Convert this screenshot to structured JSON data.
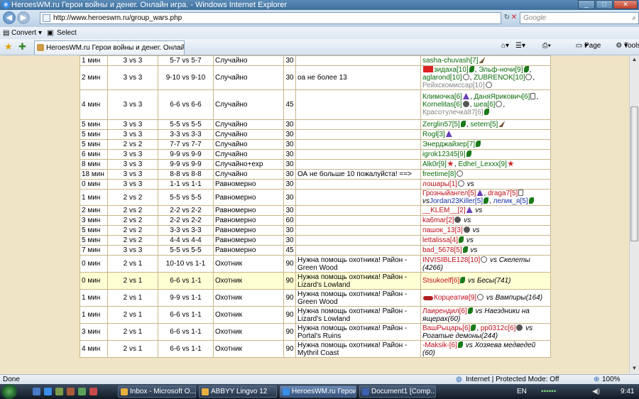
{
  "window": {
    "title": "HeroesWM.ru Герои войны и денег. Онлайн игра. - Windows Internet Explorer"
  },
  "address": {
    "url": "http://www.heroeswm.ru/group_wars.php",
    "search_placeholder": "Google"
  },
  "command_bar": {
    "convert": "Convert",
    "select": "Select"
  },
  "tab": {
    "label": "HeroesWM.ru Герои войны и денег. Онлайн иг..."
  },
  "toolbar": {
    "page": "Page",
    "tools": "Tools"
  },
  "rows": [
    {
      "time": "1 мин",
      "format": "3 vs 3",
      "levels": "5-7 vs 5-7",
      "type": "Случайно",
      "timeout": "30",
      "comment": "",
      "players": [
        {
          "name": "sasha-chuvash[7]",
          "color": "",
          "icon": "dart"
        }
      ]
    },
    {
      "time": "2 мин",
      "format": "3 vs 3",
      "levels": "9-10 vs 9-10",
      "type": "Случайно",
      "timeout": "30",
      "comment": "оа не более 13",
      "players": [
        {
          "name": "зидаха[10]",
          "color": "",
          "pre": "flag",
          "icon": "leaf"
        },
        {
          "name": "Эльф-ночи[9]",
          "color": "",
          "icon": "leaf"
        },
        {
          "name": "aglarond[10]",
          "color": "",
          "icon": "q"
        },
        {
          "name": "ZUBRENOK[10]",
          "color": "",
          "icon": "q"
        },
        {
          "name": "Рейхскомиссар[10]",
          "color": "grey",
          "icon": "q"
        }
      ]
    },
    {
      "time": "4 мин",
      "format": "3 vs 3",
      "levels": "6-6 vs 6-6",
      "type": "Случайно",
      "timeout": "45",
      "comment": "",
      "players": [
        {
          "name": "Климочка[6]",
          "color": "",
          "icon": "wiz"
        },
        {
          "name": "ДаняЯрикович[6]",
          "color": "",
          "icon": "cross"
        },
        {
          "name": "Kornelitas[6]",
          "color": "",
          "icon": "skull"
        },
        {
          "name": "шеа[6]",
          "color": "",
          "icon": "q"
        },
        {
          "name": "Красотулечка87[6]",
          "color": "grey",
          "icon": "leaf"
        }
      ]
    },
    {
      "time": "5 мин",
      "format": "3 vs 3",
      "levels": "5-5 vs 5-5",
      "type": "Случайно",
      "timeout": "30",
      "comment": "",
      "players": [
        {
          "name": "Zerglin57[5]",
          "color": "",
          "icon": "leaf"
        },
        {
          "name": "setern[5]",
          "color": "",
          "icon": "dart"
        }
      ]
    },
    {
      "time": "5 мин",
      "format": "3 vs 3",
      "levels": "3-3 vs 3-3",
      "type": "Случайно",
      "timeout": "30",
      "comment": "",
      "players": [
        {
          "name": "Rogl[3]",
          "color": "",
          "icon": "wiz"
        }
      ]
    },
    {
      "time": "5 мин",
      "format": "2 vs 2",
      "levels": "7-7 vs 7-7",
      "type": "Случайно",
      "timeout": "30",
      "comment": "",
      "players": [
        {
          "name": "Энерджайзер[7]",
          "color": "",
          "icon": "leaf"
        }
      ]
    },
    {
      "time": "6 мин",
      "format": "3 vs 3",
      "levels": "9-9 vs 9-9",
      "type": "Случайно",
      "timeout": "30",
      "comment": "",
      "players": [
        {
          "name": "igrok12345[9]",
          "color": "",
          "icon": "leaf"
        }
      ]
    },
    {
      "time": "8 мин",
      "format": "3 vs 3",
      "levels": "9-9 vs 9-9",
      "type": "Случайно+exp",
      "timeout": "30",
      "comment": "",
      "players": [
        {
          "name": "Alk0r[9]",
          "color": "",
          "icon": "star"
        },
        {
          "name": "Edhel_Lexxx[9]",
          "color": "",
          "icon": "star"
        }
      ]
    },
    {
      "time": "18 мин",
      "format": "3 vs 3",
      "levels": "8-8 vs 8-8",
      "type": "Случайно",
      "timeout": "30",
      "comment": "ОА не больше 10 пожалуйста! ==>",
      "players": [
        {
          "name": "freetime[8]",
          "color": "",
          "icon": "q"
        }
      ]
    },
    {
      "time": "0 мин",
      "format": "3 vs 3",
      "levels": "1-1 vs 1-1",
      "type": "Равномерно",
      "timeout": "30",
      "comment": "",
      "players": [
        {
          "name": "лошары[1]",
          "color": "red",
          "icon": "q",
          "vs": "vs"
        }
      ]
    },
    {
      "time": "1 мин",
      "format": "2 vs 2",
      "levels": "5-5 vs 5-5",
      "type": "Равномерно",
      "timeout": "30",
      "comment": "",
      "players": [
        {
          "name": "Грозныйангел[5]",
          "color": "red",
          "icon": "wiz"
        },
        {
          "name": "draga7[5]",
          "color": "red",
          "icon": "cross",
          "vs": "vs"
        },
        {
          "name": "Jordan23Killer[5]",
          "color": "blue",
          "icon": "leaf"
        },
        {
          "name": "лелик_я[5]",
          "color": "blue",
          "icon": "leaf"
        }
      ]
    },
    {
      "time": "2 мин",
      "format": "2 vs 2",
      "levels": "2-2 vs 2-2",
      "type": "Равномерно",
      "timeout": "30",
      "comment": "",
      "players": [
        {
          "name": "__KLEM__[2]",
          "color": "red",
          "icon": "wiz",
          "vs": "vs"
        }
      ]
    },
    {
      "time": "3 мин",
      "format": "2 vs 2",
      "levels": "2-2 vs 2-2",
      "type": "Равномерно",
      "timeout": "60",
      "comment": "",
      "players": [
        {
          "name": "ka6mar[2]",
          "color": "red",
          "icon": "skull",
          "vs": "vs"
        }
      ]
    },
    {
      "time": "5 мин",
      "format": "2 vs 2",
      "levels": "3-3 vs 3-3",
      "type": "Равномерно",
      "timeout": "30",
      "comment": "",
      "players": [
        {
          "name": "пашок_13[3]",
          "color": "red",
          "icon": "skull",
          "vs": "vs"
        }
      ]
    },
    {
      "time": "5 мин",
      "format": "2 vs 2",
      "levels": "4-4 vs 4-4",
      "type": "Равномерно",
      "timeout": "30",
      "comment": "",
      "players": [
        {
          "name": "lettalissa[4]",
          "color": "red",
          "icon": "leaf",
          "vs": "vs"
        }
      ]
    },
    {
      "time": "7 мин",
      "format": "3 vs 3",
      "levels": "5-5 vs 5-5",
      "type": "Равномерно",
      "timeout": "45",
      "comment": "",
      "players": [
        {
          "name": "bad_5678[5]",
          "color": "red",
          "icon": "leaf",
          "vs": "vs"
        }
      ]
    },
    {
      "time": "0 мин",
      "format": "2 vs 1",
      "levels": "10-10 vs 1-1",
      "type": "Охотник",
      "timeout": "90",
      "comment": "Нужна помощь охотника! Район - Green Wood",
      "players": [
        {
          "name": "INVISIBLE128[10]",
          "color": "red",
          "icon": "q",
          "vs": "vs Скелеты (4266)"
        }
      ]
    },
    {
      "time": "0 мин",
      "format": "2 vs 1",
      "levels": "6-6 vs 1-1",
      "type": "Охотник",
      "timeout": "90",
      "comment": "Нужна помощь охотника! Район - Lizard's Lowland",
      "hl": true,
      "players": [
        {
          "name": "Stsukoelf[6]",
          "color": "red",
          "icon": "leaf",
          "vs": "vs Бесы(741)"
        }
      ]
    },
    {
      "time": "1 мин",
      "format": "2 vs 1",
      "levels": "9-9 vs 1-1",
      "type": "Охотник",
      "timeout": "90",
      "comment": "Нужна помощь охотника! Район - Green Wood",
      "players": [
        {
          "name": "Корцеатив[9]",
          "color": "red",
          "pre": "swords",
          "icon": "q",
          "vs": "vs Вампиры(164)"
        }
      ]
    },
    {
      "time": "1 мин",
      "format": "2 vs 1",
      "levels": "6-6 vs 1-1",
      "type": "Охотник",
      "timeout": "90",
      "comment": "Нужна помощь охотника! Район - Lizard's Lowland",
      "players": [
        {
          "name": "Лаирендил[6]",
          "color": "red",
          "icon": "leaf",
          "vs": "vs Наездники на ящерах(60)"
        }
      ]
    },
    {
      "time": "3 мин",
      "format": "2 vs 1",
      "levels": "6-6 vs 1-1",
      "type": "Охотник",
      "timeout": "90",
      "comment": "Нужна помощь охотника! Район - Portal's Ruins",
      "players": [
        {
          "name": "ВашРыцарь[6]",
          "color": "red",
          "icon": "leaf"
        },
        {
          "name": "pp0312c[6]",
          "color": "red",
          "icon": "skull",
          "vs": "vs Рогатые демоны(244)"
        }
      ]
    },
    {
      "time": "4 мин",
      "format": "2 vs 1",
      "levels": "6-6 vs 1-1",
      "type": "Охотник",
      "timeout": "90",
      "comment": "Нужна помощь охотника! Район - Mythril Coast",
      "players": [
        {
          "name": "-Maksik-[6]",
          "color": "red",
          "icon": "leaf",
          "vs": "vs Хозяева медведей (60)"
        }
      ]
    }
  ],
  "status": {
    "left": "Done",
    "zone": "Internet | Protected Mode: Off",
    "zoom": "100%"
  },
  "taskbar": {
    "tasks": [
      "Inbox - Microsoft O...",
      "ABBYY Lingvo 12",
      "HeroesWM.ru Герои...",
      "Document1 [Comp..."
    ],
    "lang": "EN",
    "clock": "9:41"
  }
}
